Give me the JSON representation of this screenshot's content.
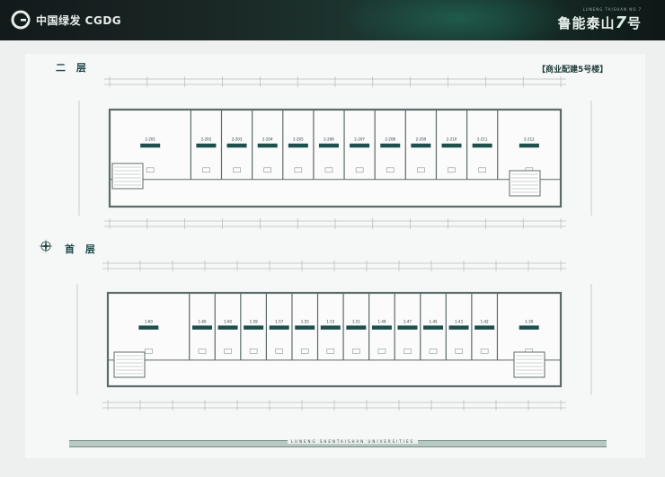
{
  "header": {
    "logo_text": "中国绿发 CGDG",
    "brand_sub": "LUNENG TAISHAN NO.7",
    "brand_main": "鲁能泰山",
    "brand_seven": "7",
    "brand_suffix": "号"
  },
  "building_label": "【商业配建5号楼】",
  "floors": [
    {
      "label": "二 层",
      "units": [
        "2-201",
        "2-202",
        "2-203",
        "2-204",
        "2-205",
        "2-206",
        "2-207",
        "2-208",
        "2-209",
        "2-210",
        "2-211",
        "2-212"
      ]
    },
    {
      "label": "首 层",
      "units": [
        "1-60",
        "1-60",
        "1-60",
        "1-59",
        "1-57",
        "1-55",
        "1-53",
        "1-51",
        "1-49",
        "1-47",
        "1-45",
        "1-43",
        "1-42",
        "1-39"
      ]
    }
  ],
  "footer_text": "LUNENG SHENTAISHAN UNIVERSITIES",
  "colors": {
    "tag": "#1d4f4c",
    "wall": "#5c6a6a",
    "accent": "#1f4a49"
  }
}
